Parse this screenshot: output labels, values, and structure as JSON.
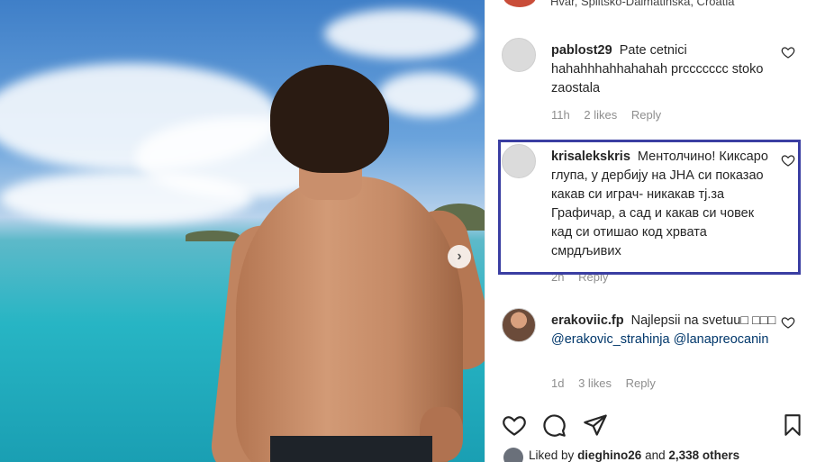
{
  "post": {
    "location": "Hvar, Splitsko-Dalmatinska, Croatia"
  },
  "comments": [
    {
      "username": "pablost29",
      "text": "Pate cetnici hahahhhahhahahah prccccccc stoko zaostala",
      "time": "11h",
      "likes": "2 likes",
      "reply": "Reply"
    },
    {
      "username": "krisalekskris",
      "text": "Ментолчино! Киксаро глупа, у дербију на ЈНА си показао какав си играч- никакав тј.за Графичар, а сад и какав си човек кад си отишао код хрвата смрдљивих",
      "time": "2h",
      "reply": "Reply"
    },
    {
      "username": "erakoviic.fp",
      "text": "Najlepsii na svetuu□ □□□",
      "mention1": "@erakovic_strahinja",
      "mention2": "@lanapreocanin",
      "time": "1d",
      "likes": "3 likes",
      "reply": "Reply"
    }
  ],
  "liked_by": {
    "prefix": "Liked by",
    "user": "dieghino26",
    "mid": "and",
    "others": "2,338 others"
  },
  "icons": {
    "like": "heart-icon",
    "comment": "comment-icon",
    "share": "send-icon",
    "save": "bookmark-icon",
    "next": "chevron-right-icon"
  },
  "colors": {
    "highlight_box": "#3a3ea2",
    "meta_text": "#8e8e8e",
    "mention": "#00376b"
  }
}
